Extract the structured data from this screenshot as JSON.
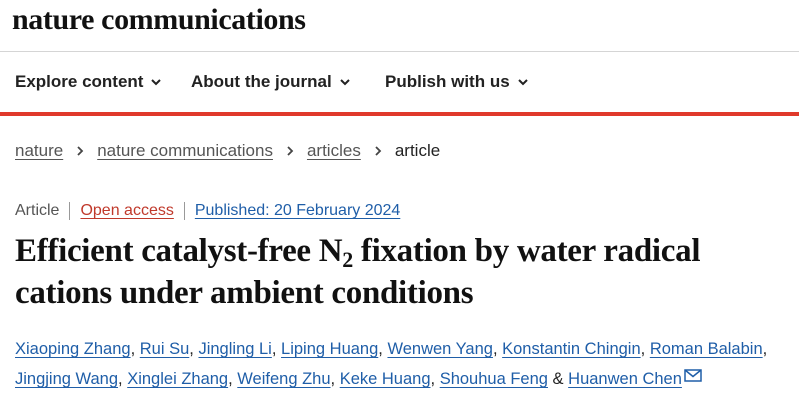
{
  "site": {
    "logo": "nature communications"
  },
  "nav": {
    "items": [
      {
        "label": "Explore content"
      },
      {
        "label": "About the journal"
      },
      {
        "label": "Publish with us"
      }
    ]
  },
  "breadcrumb": {
    "items": [
      "nature",
      "nature communications",
      "articles"
    ],
    "current": "article"
  },
  "article": {
    "type": "Article",
    "access": "Open access",
    "published": "Published: 20 February 2024",
    "title_part1": "Efficient catalyst-free N",
    "title_sub": "2",
    "title_part2": " fixation by water radical cations under ambient conditions",
    "authors": [
      "Xiaoping Zhang",
      "Rui Su",
      "Jingling Li",
      "Liping Huang",
      "Wenwen Yang",
      "Konstantin Chingin",
      "Roman Balabin",
      "Jingjing Wang",
      "Xinglei Zhang",
      "Weifeng Zhu",
      "Keke Huang",
      "Shouhua Feng",
      "Huanwen Chen"
    ],
    "author_separator": ",",
    "author_last_joiner": "&"
  },
  "icons": {
    "nav_dropdown": "chevron-down-icon",
    "breadcrumb_sep": "chevron-right-icon",
    "email": "mail-icon"
  },
  "colors": {
    "nav_underline": "#e0392b",
    "link_blue": "#1f5ea8",
    "open_access": "#c0392b"
  }
}
